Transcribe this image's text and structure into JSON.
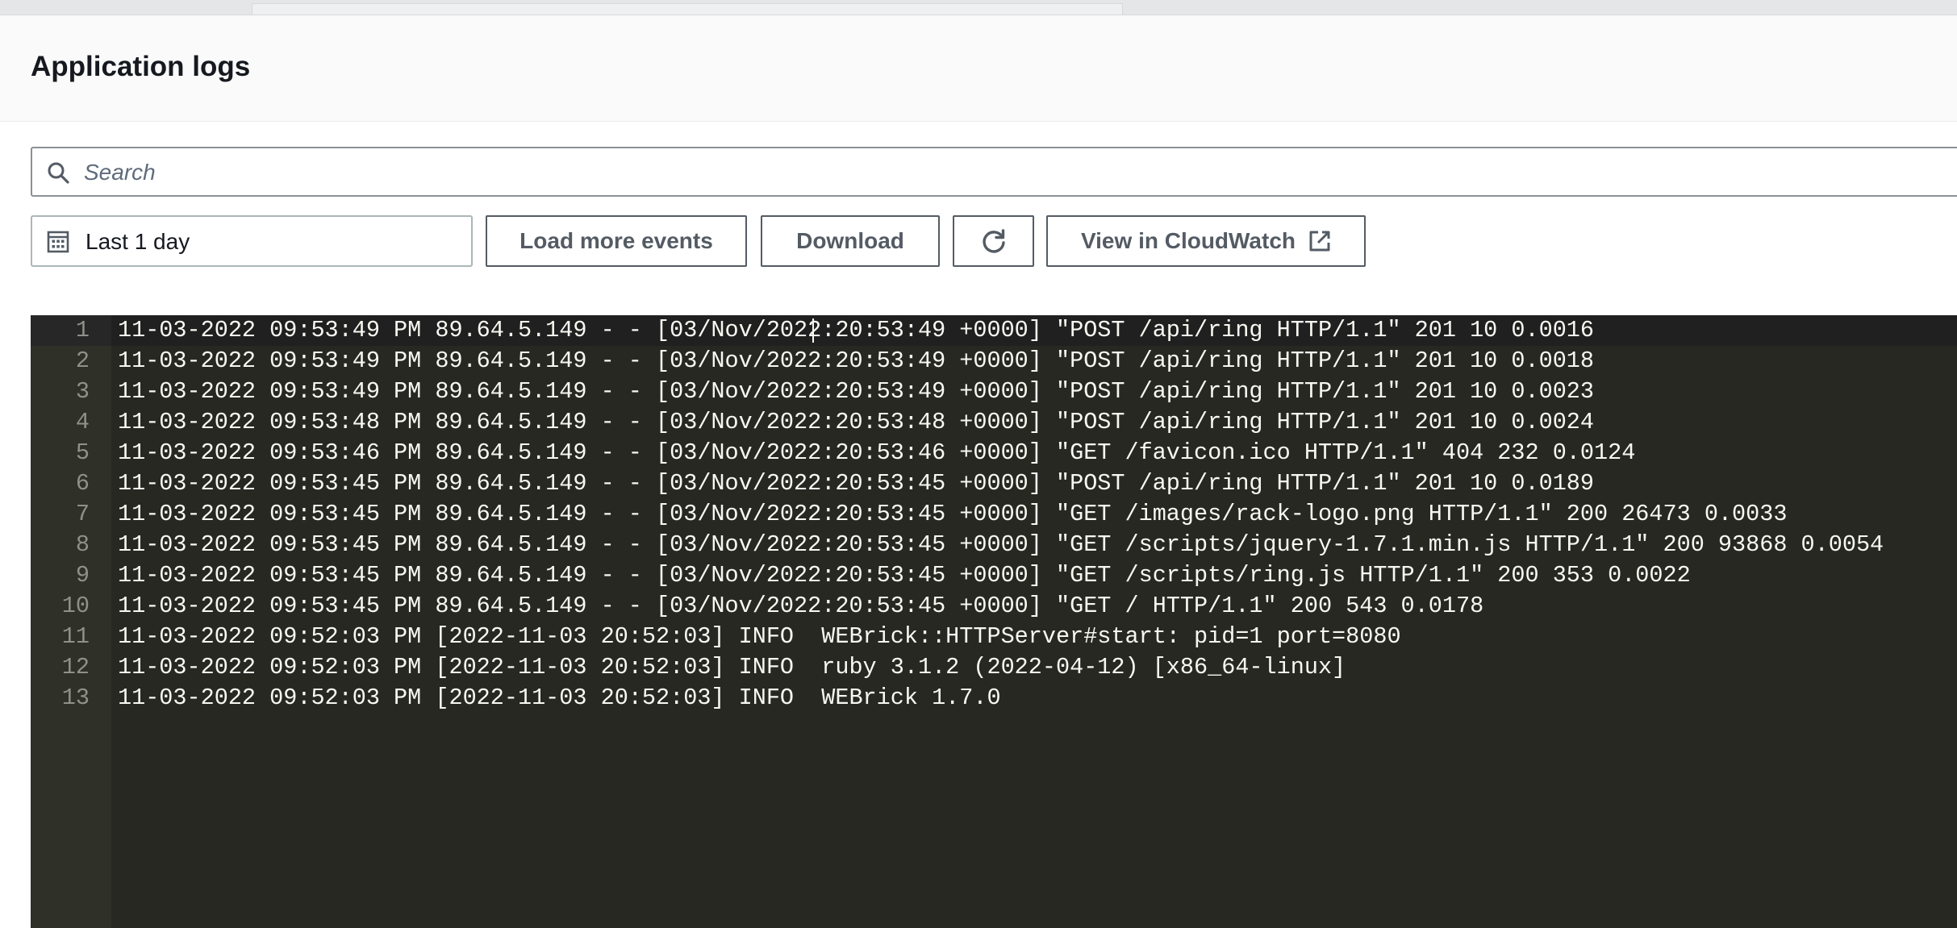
{
  "panel": {
    "title": "Application logs"
  },
  "search": {
    "placeholder": "Search",
    "value": ""
  },
  "toolbar": {
    "date_range_label": "Last 1 day",
    "load_more_label": "Load more events",
    "download_label": "Download",
    "view_cloudwatch_label": "View in CloudWatch"
  },
  "icons": {
    "search": "search-icon",
    "calendar": "calendar-icon",
    "refresh": "refresh-icon",
    "external_link": "external-link-icon"
  },
  "colors": {
    "log_background": "#272822",
    "log_text": "#f8f8f2",
    "line_number": "#8f908a",
    "button_border": "#545b64"
  },
  "log": {
    "lines": [
      {
        "no": "1",
        "text": "11-03-2022 09:53:49 PM 89.64.5.149 - - [03/Nov/2022:20:53:49 +0000] \"POST /api/ring HTTP/1.1\" 201 10 0.0016"
      },
      {
        "no": "2",
        "text": "11-03-2022 09:53:49 PM 89.64.5.149 - - [03/Nov/2022:20:53:49 +0000] \"POST /api/ring HTTP/1.1\" 201 10 0.0018"
      },
      {
        "no": "3",
        "text": "11-03-2022 09:53:49 PM 89.64.5.149 - - [03/Nov/2022:20:53:49 +0000] \"POST /api/ring HTTP/1.1\" 201 10 0.0023"
      },
      {
        "no": "4",
        "text": "11-03-2022 09:53:48 PM 89.64.5.149 - - [03/Nov/2022:20:53:48 +0000] \"POST /api/ring HTTP/1.1\" 201 10 0.0024"
      },
      {
        "no": "5",
        "text": "11-03-2022 09:53:46 PM 89.64.5.149 - - [03/Nov/2022:20:53:46 +0000] \"GET /favicon.ico HTTP/1.1\" 404 232 0.0124"
      },
      {
        "no": "6",
        "text": "11-03-2022 09:53:45 PM 89.64.5.149 - - [03/Nov/2022:20:53:45 +0000] \"POST /api/ring HTTP/1.1\" 201 10 0.0189"
      },
      {
        "no": "7",
        "text": "11-03-2022 09:53:45 PM 89.64.5.149 - - [03/Nov/2022:20:53:45 +0000] \"GET /images/rack-logo.png HTTP/1.1\" 200 26473 0.0033"
      },
      {
        "no": "8",
        "text": "11-03-2022 09:53:45 PM 89.64.5.149 - - [03/Nov/2022:20:53:45 +0000] \"GET /scripts/jquery-1.7.1.min.js HTTP/1.1\" 200 93868 0.0054"
      },
      {
        "no": "9",
        "text": "11-03-2022 09:53:45 PM 89.64.5.149 - - [03/Nov/2022:20:53:45 +0000] \"GET /scripts/ring.js HTTP/1.1\" 200 353 0.0022"
      },
      {
        "no": "10",
        "text": "11-03-2022 09:53:45 PM 89.64.5.149 - - [03/Nov/2022:20:53:45 +0000] \"GET / HTTP/1.1\" 200 543 0.0178"
      },
      {
        "no": "11",
        "text": "11-03-2022 09:52:03 PM [2022-11-03 20:52:03] INFO  WEBrick::HTTPServer#start: pid=1 port=8080"
      },
      {
        "no": "12",
        "text": "11-03-2022 09:52:03 PM [2022-11-03 20:52:03] INFO  ruby 3.1.2 (2022-04-12) [x86_64-linux]"
      },
      {
        "no": "13",
        "text": "11-03-2022 09:52:03 PM [2022-11-03 20:52:03] INFO  WEBrick 1.7.0"
      }
    ]
  }
}
